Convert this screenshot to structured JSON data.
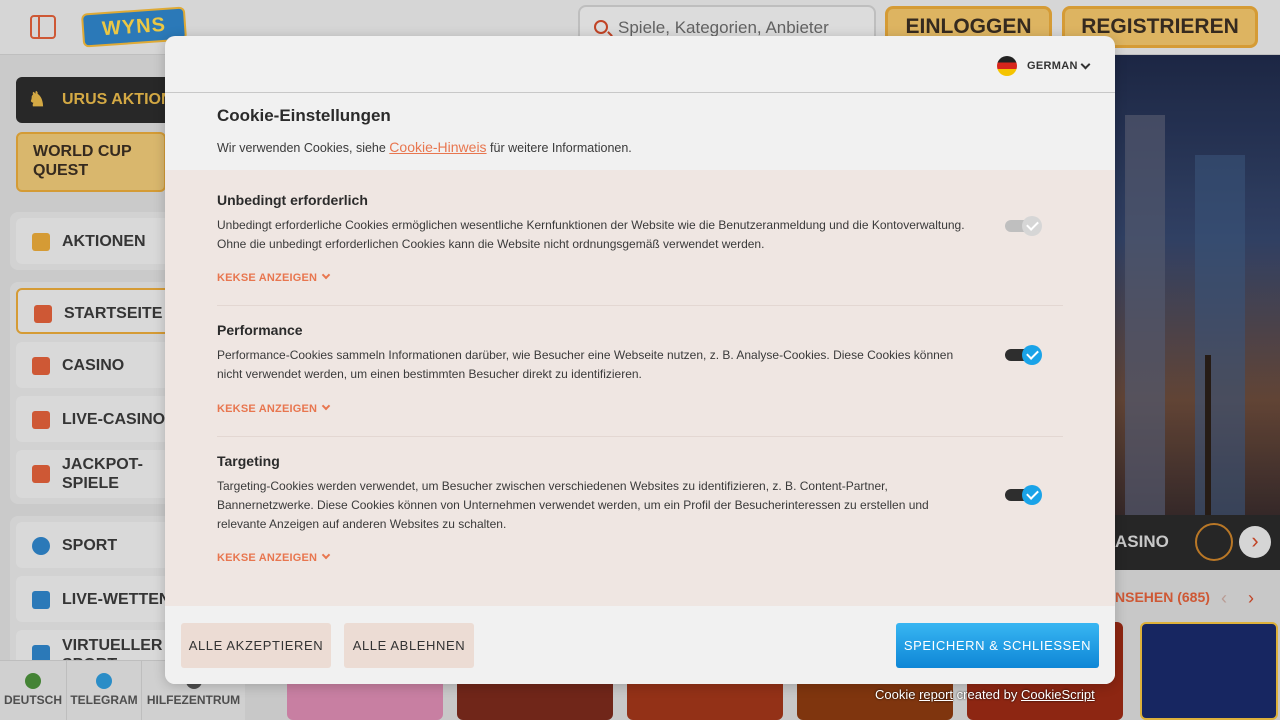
{
  "site": {
    "logo_text": "WYNS",
    "search": {
      "placeholder": "Spiele, Kategorien, Anbieter"
    },
    "header": {
      "login_label": "EINLOGGEN",
      "register_label": "REGISTRIEREN"
    },
    "sidebar": {
      "promo_dark": "URUS AKTION",
      "promo_gold": "WORLD CUP QUEST",
      "items": [
        {
          "label": "AKTIONEN",
          "icon": "gift-icon",
          "color": "#e8a93a"
        },
        {
          "label": "STARTSEITE",
          "icon": "home-icon",
          "color": "#e0603a"
        },
        {
          "label": "CASINO",
          "icon": "slot-machine-icon",
          "color": "#e0603a"
        },
        {
          "label": "LIVE-CASINO",
          "icon": "cards-icon",
          "color": "#e0603a"
        },
        {
          "label": "JACKPOT-SPIELE",
          "icon": "clover-icon",
          "color": "#e0603a"
        },
        {
          "label": "SPORT",
          "icon": "basketball-icon",
          "color": "#2f84c8"
        },
        {
          "label": "LIVE-WETTEN",
          "icon": "live-icon",
          "color": "#2f84c8"
        },
        {
          "label": "VIRTUELLER SPORT",
          "icon": "virtual-sport-icon",
          "color": "#2f84c8"
        }
      ]
    },
    "bottom_bar": [
      {
        "label": "DEUTSCH",
        "icon": "globe-icon"
      },
      {
        "label": "TELEGRAM",
        "icon": "telegram-icon"
      },
      {
        "label": "HILFEZENTRUM",
        "icon": "help-icon"
      }
    ],
    "hero_bar_text": "ASINO",
    "see_all": "NSEHEN (685)"
  },
  "cookie_modal": {
    "language": "GERMAN",
    "title": "Cookie-Einstellungen",
    "intro_before": "Wir verwenden Cookies, siehe ",
    "intro_link": "Cookie-Hinweis",
    "intro_after": " für weitere Informationen.",
    "categories": [
      {
        "title": "Unbedingt erforderlich",
        "description": "Unbedingt erforderliche Cookies ermöglichen wesentliche Kernfunktionen der Website wie die Benutzeranmeldung und die Kontoverwaltung. Ohne die unbedingt erforderlichen Cookies kann die Website nicht ordnungsgemäß verwendet werden.",
        "show_cookies": "KEKSE ANZEIGEN",
        "enabled": true,
        "locked": true
      },
      {
        "title": "Performance",
        "description": "Performance-Cookies sammeln Informationen darüber, wie Besucher eine Webseite nutzen, z. B. Analyse-Cookies. Diese Cookies können nicht verwendet werden, um einen bestimmten Besucher direkt zu identifizieren.",
        "show_cookies": "KEKSE ANZEIGEN",
        "enabled": true,
        "locked": false
      },
      {
        "title": "Targeting",
        "description": "Targeting-Cookies werden verwendet, um Besucher zwischen verschiedenen Websites zu identifizieren, z. B. Content-Partner, Bannernetzwerke. Diese Cookies können von Unternehmen verwendet werden, um ein Profil der Besucherinteressen zu erstellen und relevante Anzeigen auf anderen Websites zu schalten.",
        "show_cookies": "KEKSE ANZEIGEN",
        "enabled": true,
        "locked": false
      }
    ],
    "buttons": {
      "accept_all": "ALLE AKZEPTIEREN",
      "reject_all": "ALLE ABLEHNEN",
      "save_close": "SPEICHERN & SCHLIESSEN"
    },
    "credit": {
      "prefix": "Cookie ",
      "report": "report",
      "middle": " created by ",
      "brand": "CookieScript"
    },
    "colors": {
      "accent": "#e8764f",
      "toggle_on": "#1aa3e8",
      "save_button": "#1aa3e8"
    }
  }
}
